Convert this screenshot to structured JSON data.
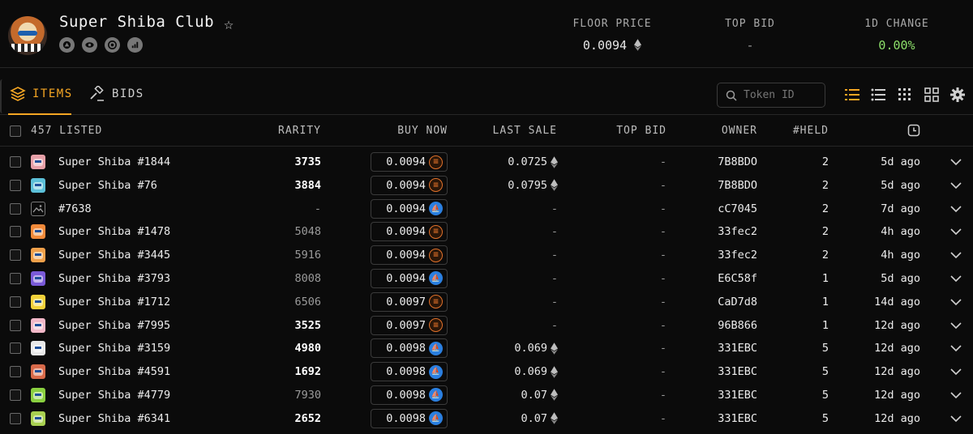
{
  "collection": {
    "name": "Super Shiba Club",
    "stats": {
      "floor_label": "FLOOR PRICE",
      "floor_value": "0.0094",
      "topbid_label": "TOP BID",
      "topbid_value": "-",
      "change_label": "1D CHANGE",
      "change_value": "0.00%"
    },
    "colors": {
      "accent": "#f5a623",
      "positive": "#8de06a"
    }
  },
  "tabs": {
    "items_label": "ITEMS",
    "bids_label": "BIDS"
  },
  "search": {
    "placeholder": "Token ID"
  },
  "table": {
    "columns": {
      "listed": "457 LISTED",
      "rarity": "RARITY",
      "buy_now": "BUY NOW",
      "last_sale": "LAST SALE",
      "top_bid": "TOP BID",
      "owner": "OWNER",
      "held": "#HELD"
    },
    "rows": [
      {
        "name": "Super Shiba #1844",
        "rarity": "3735",
        "rarity_bold": true,
        "price": "0.0094",
        "market": "orange",
        "last_sale": "0.0725",
        "top_bid": "-",
        "owner": "7B8BDO",
        "held": "2",
        "time": "5d ago",
        "thumb": "#e7a0a8"
      },
      {
        "name": "Super Shiba #76",
        "rarity": "3884",
        "rarity_bold": true,
        "price": "0.0094",
        "market": "orange",
        "last_sale": "0.0795",
        "top_bid": "-",
        "owner": "7B8BDO",
        "held": "2",
        "time": "5d ago",
        "thumb": "#5cc0d8"
      },
      {
        "name": "#7638",
        "rarity": "-",
        "rarity_bold": false,
        "price": "0.0094",
        "market": "blue",
        "last_sale": "-",
        "top_bid": "-",
        "owner": "cC7045",
        "held": "2",
        "time": "7d ago",
        "thumb": "generic"
      },
      {
        "name": "Super Shiba #1478",
        "rarity": "5048",
        "rarity_bold": false,
        "price": "0.0094",
        "market": "orange",
        "last_sale": "-",
        "top_bid": "-",
        "owner": "33fec2",
        "held": "2",
        "time": "4h ago",
        "thumb": "#f28a3a"
      },
      {
        "name": "Super Shiba #3445",
        "rarity": "5916",
        "rarity_bold": false,
        "price": "0.0094",
        "market": "orange",
        "last_sale": "-",
        "top_bid": "-",
        "owner": "33fec2",
        "held": "2",
        "time": "4h ago",
        "thumb": "#f0a04a"
      },
      {
        "name": "Super Shiba #3793",
        "rarity": "8008",
        "rarity_bold": false,
        "price": "0.0094",
        "market": "blue",
        "last_sale": "-",
        "top_bid": "-",
        "owner": "E6C58f",
        "held": "1",
        "time": "5d ago",
        "thumb": "#7a5ad8"
      },
      {
        "name": "Super Shiba #1712",
        "rarity": "6506",
        "rarity_bold": false,
        "price": "0.0097",
        "market": "orange",
        "last_sale": "-",
        "top_bid": "-",
        "owner": "CaD7d8",
        "held": "1",
        "time": "14d ago",
        "thumb": "#f2d23a"
      },
      {
        "name": "Super Shiba #7995",
        "rarity": "3525",
        "rarity_bold": true,
        "price": "0.0097",
        "market": "orange",
        "last_sale": "-",
        "top_bid": "-",
        "owner": "96B866",
        "held": "1",
        "time": "12d ago",
        "thumb": "#f2b8c8"
      },
      {
        "name": "Super Shiba #3159",
        "rarity": "4980",
        "rarity_bold": true,
        "price": "0.0098",
        "market": "blue",
        "last_sale": "0.069",
        "top_bid": "-",
        "owner": "331EBC",
        "held": "5",
        "time": "12d ago",
        "thumb": "#e8e8e8"
      },
      {
        "name": "Super Shiba #4591",
        "rarity": "1692",
        "rarity_bold": true,
        "price": "0.0098",
        "market": "blue",
        "last_sale": "0.069",
        "top_bid": "-",
        "owner": "331EBC",
        "held": "5",
        "time": "12d ago",
        "thumb": "#d86a4a"
      },
      {
        "name": "Super Shiba #4779",
        "rarity": "7930",
        "rarity_bold": false,
        "price": "0.0098",
        "market": "blue",
        "last_sale": "0.07",
        "top_bid": "-",
        "owner": "331EBC",
        "held": "5",
        "time": "12d ago",
        "thumb": "#8ad040"
      },
      {
        "name": "Super Shiba #6341",
        "rarity": "2652",
        "rarity_bold": true,
        "price": "0.0098",
        "market": "blue",
        "last_sale": "0.07",
        "top_bid": "-",
        "owner": "331EBC",
        "held": "5",
        "time": "12d ago",
        "thumb": "#a8d050"
      }
    ]
  }
}
